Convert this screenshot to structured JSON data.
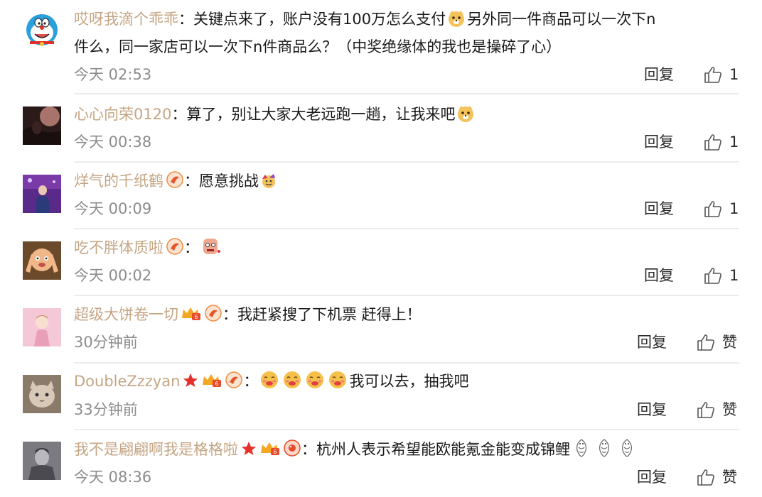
{
  "comments": [
    {
      "username": "哎呀我滴个乖乖",
      "text_a": "关键点来了，账户没有100万怎么支付",
      "text_b": "另外同一件商品可以一次下n",
      "text_c": "件么，同一家店可以一次下n件商品么？（中奖绝缘体的我也是操碎了心）",
      "time": "今天 02:53",
      "reply_label": "回复",
      "like_label": "1"
    },
    {
      "username": "心心向荣0120",
      "text_a": "算了，别让大家大老远跑一趟，让我来吧",
      "time": "今天 00:38",
      "reply_label": "回复",
      "like_label": "1"
    },
    {
      "username": "烊气的千纸鹤",
      "text_a": "愿意挑战",
      "time": "今天 00:09",
      "reply_label": "回复",
      "like_label": "1"
    },
    {
      "username": "吃不胖体质啦",
      "time": "今天 00:02",
      "reply_label": "回复",
      "like_label": "1"
    },
    {
      "username": "超级大饼卷一切",
      "text_a": "我赶紧搜了下机票 赶得上！",
      "time": "30分钟前",
      "reply_label": "回复",
      "like_label": "赞"
    },
    {
      "username": "DoubleZzzyan",
      "text_a": "我可以去，抽我吧",
      "time": "33分钟前",
      "reply_label": "回复",
      "like_label": "赞"
    },
    {
      "username": "我不是翩翩啊我是格格啦",
      "text_a": "杭州人表示希望能欧能氪金能变成锦鲤",
      "time": "今天 08:36",
      "reply_label": "回复",
      "like_label": "赞"
    }
  ],
  "colon": "：",
  "colors": {
    "username": "#c5a583",
    "time": "#8c8c8c",
    "text": "#1a1a1a",
    "divider": "#ececec"
  },
  "icons": {
    "like": "thumbs-up-icon",
    "emoji_cat": "doge-cat-emoji",
    "emoji_grin": "blushing-grin-emoji",
    "emoji_koi": "koi-emoji",
    "badge_level": "weibo-level-badge",
    "badge_vip": "vip-crown-badge",
    "badge_star": "red-star-badge",
    "badge_fan": "fan-badge"
  }
}
